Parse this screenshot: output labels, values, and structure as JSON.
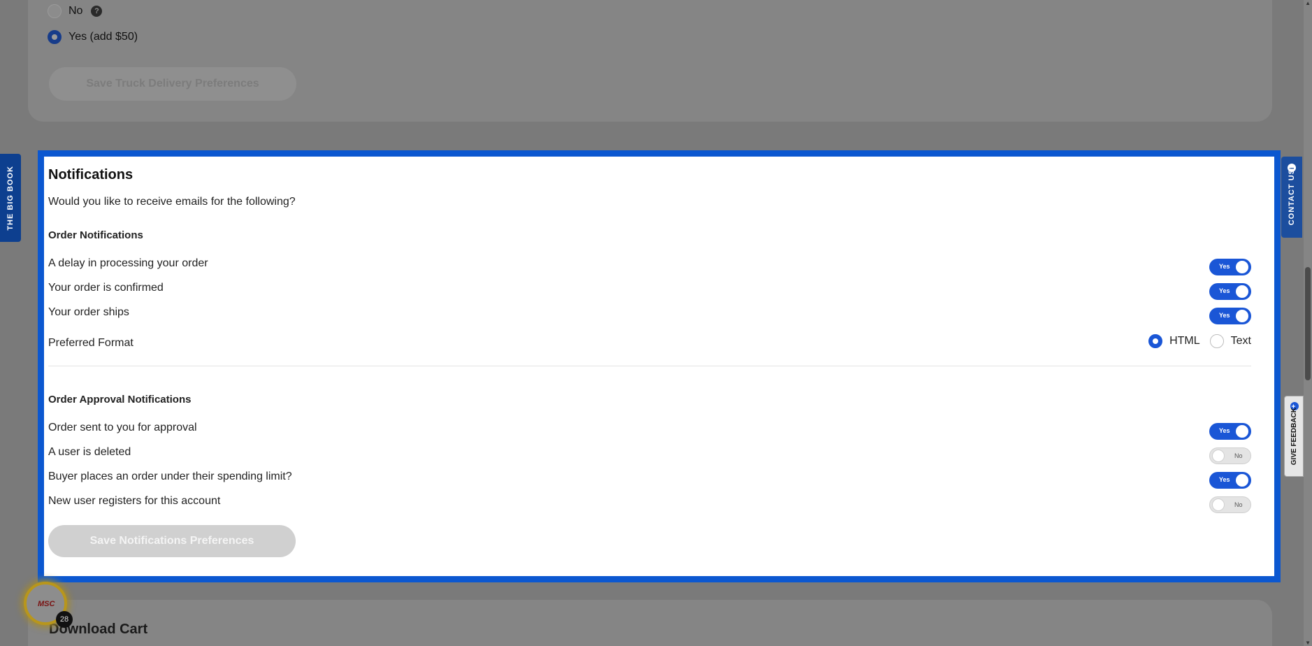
{
  "truck_delivery": {
    "option_no": "No",
    "option_yes": "Yes (add $50)",
    "help_icon": "?",
    "save_label": "Save Truck Delivery Preferences"
  },
  "notifications": {
    "title": "Notifications",
    "subtitle": "Would you like to receive emails for the following?",
    "order_section": {
      "heading": "Order Notifications",
      "items": [
        {
          "label": "A delay in processing your order",
          "state": "Yes"
        },
        {
          "label": "Your order is confirmed",
          "state": "Yes"
        },
        {
          "label": "Your order ships",
          "state": "Yes"
        }
      ],
      "format_label": "Preferred Format",
      "format_options": [
        "HTML",
        "Text"
      ],
      "format_selected": "HTML"
    },
    "approval_section": {
      "heading": "Order Approval Notifications",
      "items": [
        {
          "label": "Order sent to you for approval",
          "state": "Yes"
        },
        {
          "label": "A user is deleted",
          "state": "No"
        },
        {
          "label": "Buyer places an order under their spending limit?",
          "state": "Yes"
        },
        {
          "label": "New user registers for this account",
          "state": "No"
        }
      ]
    },
    "save_label": "Save Notifications Preferences"
  },
  "side_tabs": {
    "big_book": "THE BIG BOOK",
    "contact_us": "CONTACT US",
    "give_feedback": "GIVE FEEDBACK"
  },
  "chat_badge": {
    "logo_text": "MSC",
    "count": "28"
  },
  "download_cart": {
    "title": "Download Cart"
  },
  "colors": {
    "accent": "#0b57d0",
    "toggle_on": "#1a56d6"
  }
}
